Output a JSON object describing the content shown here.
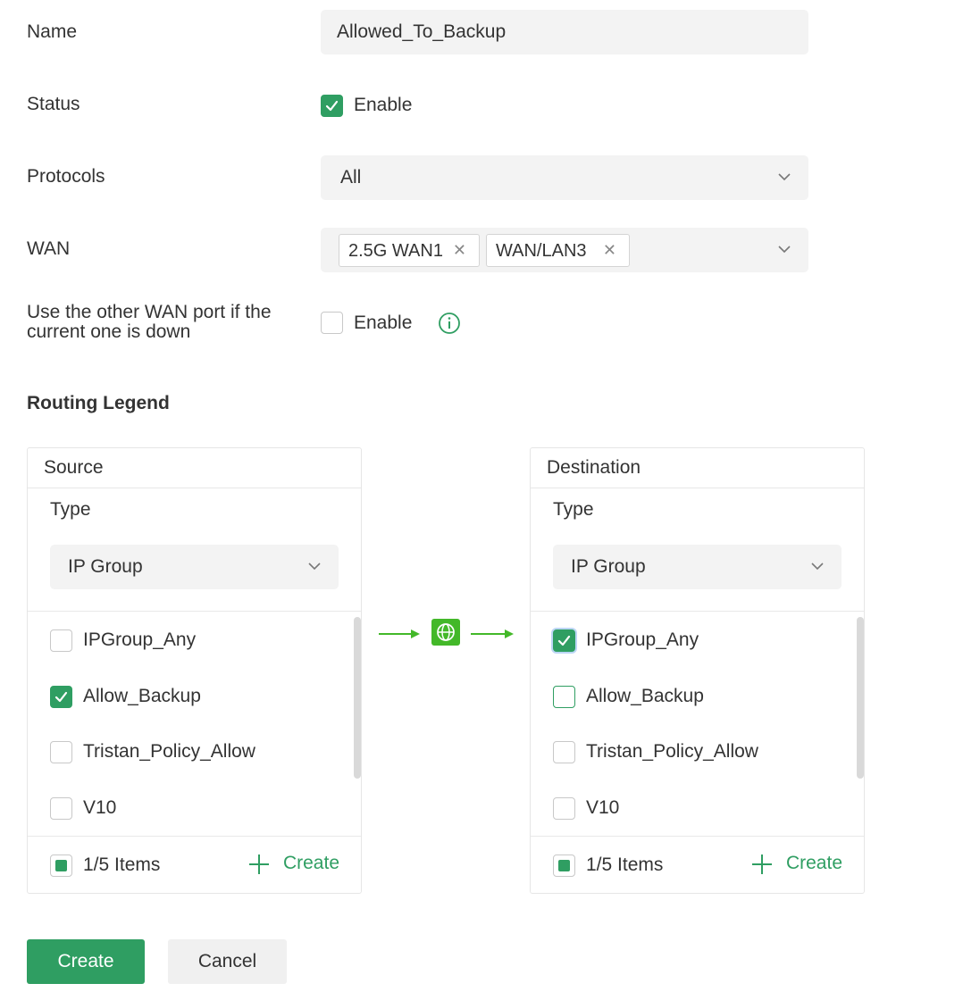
{
  "form": {
    "name_label": "Name",
    "name_value": "Allowed_To_Backup",
    "status_label": "Status",
    "status_enable_label": "Enable",
    "status_checked": true,
    "protocols_label": "Protocols",
    "protocols_value": "All",
    "wan_label": "WAN",
    "wan_tags": [
      "2.5G WAN1",
      "WAN/LAN3"
    ],
    "failover_label": "Use the other WAN port if the current one is down",
    "failover_enable_label": "Enable",
    "failover_checked": false
  },
  "routing": {
    "title": "Routing Legend",
    "source": {
      "header": "Source",
      "type_label": "Type",
      "type_value": "IP Group",
      "items": [
        {
          "label": "IPGroup_Any",
          "checked": false
        },
        {
          "label": "Allow_Backup",
          "checked": true
        },
        {
          "label": "Tristan_Policy_Allow",
          "checked": false
        },
        {
          "label": "V10",
          "checked": false
        }
      ],
      "count": "1/5 Items",
      "create_label": "Create"
    },
    "destination": {
      "header": "Destination",
      "type_label": "Type",
      "type_value": "IP Group",
      "items": [
        {
          "label": "IPGroup_Any",
          "checked": true
        },
        {
          "label": "Allow_Backup",
          "checked": false
        },
        {
          "label": "Tristan_Policy_Allow",
          "checked": false
        },
        {
          "label": "V10",
          "checked": false
        }
      ],
      "count": "1/5 Items",
      "create_label": "Create"
    }
  },
  "buttons": {
    "create": "Create",
    "cancel": "Cancel"
  },
  "colors": {
    "accent": "#2f9e62",
    "globe": "#43b829",
    "field_bg": "#f3f3f3"
  },
  "icons": {
    "chevron": "chevron-down-icon",
    "tag_close": "close-icon",
    "info": "info-icon",
    "globe": "globe-icon",
    "arrow": "arrow-right-icon",
    "plus": "plus-icon",
    "check": "check-icon"
  }
}
